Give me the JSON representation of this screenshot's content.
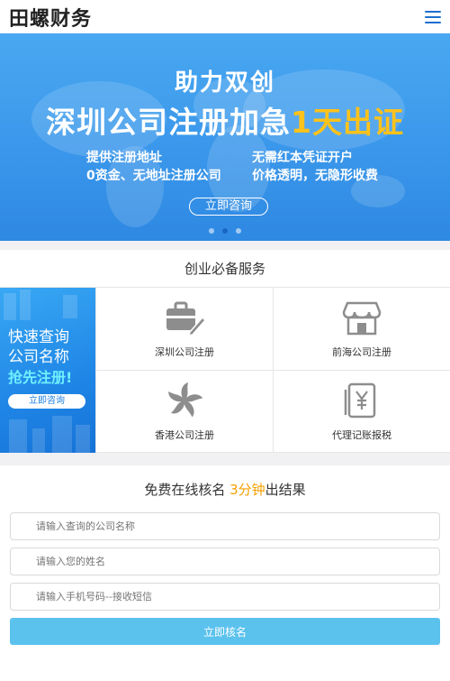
{
  "header": {
    "logo": "田螺财务",
    "menu_icon": "menu-icon"
  },
  "banner": {
    "title_top": "助力双创",
    "headline_main": "深圳公司注册加急",
    "headline_highlight": "1天出证",
    "feature_left_1": "提供注册地址",
    "feature_left_2": "0资金、无地址注册公司",
    "feature_right_1": "无需红本凭证开户",
    "feature_right_2": "价格透明，无隐形收费",
    "button": "立即咨询",
    "highlight_color": "#ffc21a",
    "slides": 3,
    "active_slide": 2
  },
  "services": {
    "title": "创业必备服务",
    "promo": {
      "line1": "快速查询",
      "line2": "公司名称",
      "line3": "抢先注册!",
      "button": "立即咨询"
    },
    "items": [
      {
        "label": "深圳公司注册",
        "icon": "briefcase-pen-icon"
      },
      {
        "label": "前海公司注册",
        "icon": "shop-awning-icon"
      },
      {
        "label": "香港公司注册",
        "icon": "bauhinia-flower-icon"
      },
      {
        "label": "代理记账报税",
        "icon": "yuan-document-icon"
      }
    ]
  },
  "form": {
    "title_prefix": "免费在线核名 ",
    "title_highlight": "3分钟",
    "title_suffix": "出结果",
    "highlight_color": "#f5a000",
    "company_placeholder": "请输入查询的公司名称",
    "name_placeholder": "请输入您的姓名",
    "phone_placeholder": "请输入手机号码--接收短信",
    "submit": "立即核名"
  }
}
